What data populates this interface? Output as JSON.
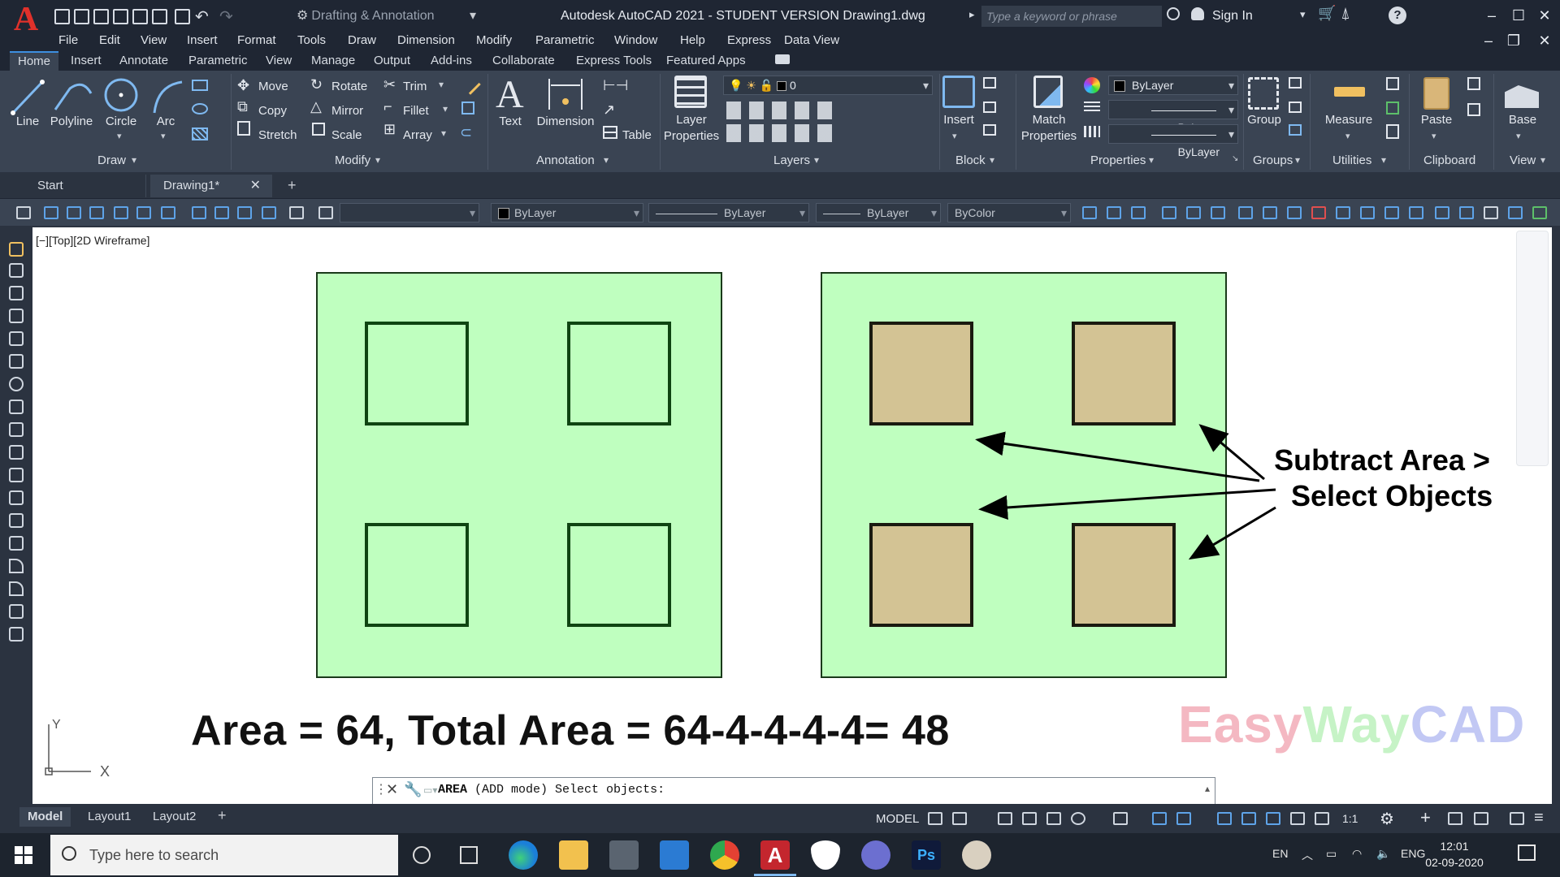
{
  "app": {
    "title": "Autodesk AutoCAD 2021 - STUDENT VERSION    Drawing1.dwg",
    "workspace": "Drafting & Annotation",
    "search_placeholder": "Type a keyword or phrase",
    "sign_in": "Sign In"
  },
  "menus": [
    "File",
    "Edit",
    "View",
    "Insert",
    "Format",
    "Tools",
    "Draw",
    "Dimension",
    "Modify",
    "Parametric",
    "Window",
    "Help",
    "Express",
    "Data View"
  ],
  "ribbon_tabs": [
    "Home",
    "Insert",
    "Annotate",
    "Parametric",
    "View",
    "Manage",
    "Output",
    "Add-ins",
    "Collaborate",
    "Express Tools",
    "Featured Apps"
  ],
  "ribbon": {
    "draw": {
      "title": "Draw",
      "line": "Line",
      "polyline": "Polyline",
      "circle": "Circle",
      "arc": "Arc"
    },
    "modify": {
      "title": "Modify",
      "move": "Move",
      "rotate": "Rotate",
      "trim": "Trim",
      "copy": "Copy",
      "mirror": "Mirror",
      "fillet": "Fillet",
      "stretch": "Stretch",
      "scale": "Scale",
      "array": "Array"
    },
    "annotation": {
      "title": "Annotation",
      "text": "Text",
      "dimension": "Dimension",
      "table": "Table"
    },
    "layers": {
      "title": "Layers",
      "layer_properties_1": "Layer",
      "layer_properties_2": "Properties",
      "current_layer": "0"
    },
    "block": {
      "title": "Block",
      "insert": "Insert"
    },
    "properties": {
      "title": "Properties",
      "match_1": "Match",
      "match_2": "Properties",
      "color": "ByLayer",
      "linetype": "ByLayer",
      "lineweight": "ByLayer"
    },
    "groups": {
      "title": "Groups",
      "group": "Group"
    },
    "utilities": {
      "title": "Utilities",
      "measure": "Measure"
    },
    "clipboard": {
      "title": "Clipboard",
      "paste": "Paste"
    },
    "view": {
      "title": "View",
      "base": "Base"
    }
  },
  "doc_tabs": {
    "start": "Start",
    "drawing": "Drawing1*"
  },
  "toolbar": {
    "color": "ByLayer",
    "linetype": "ByLayer",
    "lineweight": "ByLayer",
    "plotstyle": "ByColor"
  },
  "canvas": {
    "view_label": "[−][Top][2D Wireframe]",
    "callout_line1": "Subtract Area >",
    "callout_line2": "Select Objects",
    "formula": "Area = 64, Total Area = 64-4-4-4-4= 48",
    "watermark": {
      "easy": "Easy",
      "way": "Way",
      "cad": "CAD"
    },
    "ucs_x": "X",
    "ucs_y": "Y"
  },
  "command_line": {
    "command": "AREA",
    "text": "(ADD mode) Select objects:"
  },
  "layout_tabs": [
    "Model",
    "Layout1",
    "Layout2"
  ],
  "status": {
    "model": "MODEL",
    "scale": "1:1"
  },
  "taskbar": {
    "search": "Type here to search",
    "lang1": "EN",
    "lang2": "ENG",
    "time": "12:01",
    "date": "02-09-2020"
  },
  "colors": {
    "region_fill": "#bfffbf",
    "hole_fill": "#d3c394",
    "watermark_easy": "#f4b8c2",
    "watermark_way": "#c6f3c6",
    "watermark_cad": "#c2c8f4"
  },
  "icons": [
    "search-icon",
    "user-icon",
    "cart-icon",
    "help-icon",
    "gear-icon",
    "close-icon",
    "wrench-icon",
    "windows-icon",
    "edge-icon",
    "explorer-icon",
    "store-icon",
    "mail-icon",
    "chrome-icon",
    "autocad-icon",
    "shield-icon",
    "photoshop-icon",
    "paint-icon"
  ]
}
